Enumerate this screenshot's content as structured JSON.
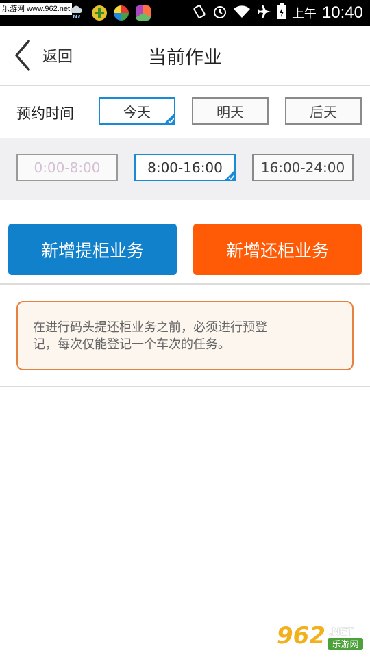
{
  "status_bar": {
    "watermark": "乐游网 www.962.net",
    "ampm": "上午",
    "time": "10:40",
    "icons": [
      "app-icon-1",
      "app-icon-2",
      "app-icon-3",
      "weather-icon",
      "game-icon",
      "color-app-icon",
      "colorful-app-icon",
      "rotate-icon",
      "alarm-icon",
      "wifi-icon",
      "airplane-icon",
      "battery-icon"
    ]
  },
  "header": {
    "back_label": "返回",
    "title": "当前作业"
  },
  "date_row": {
    "label": "预约时间",
    "options": [
      {
        "label": "今天",
        "selected": true
      },
      {
        "label": "明天",
        "selected": false
      },
      {
        "label": "后天",
        "selected": false
      }
    ]
  },
  "time_row": {
    "options": [
      {
        "label": "0:00-8:00",
        "disabled": true,
        "selected": false
      },
      {
        "label": "8:00-16:00",
        "disabled": false,
        "selected": true
      },
      {
        "label": "16:00-24:00",
        "disabled": false,
        "selected": false
      }
    ]
  },
  "actions": {
    "pickup_label": "新增提柜业务",
    "return_label": "新增还柜业务"
  },
  "notice": {
    "text_line1": "在进行码头提还柜业务之前，必须进行预登",
    "text_line2": "记，每次仅能登记一个车次的任务。"
  },
  "logo": {
    "main": "962",
    "suffix": ".NET",
    "sub": "乐游网"
  },
  "colors": {
    "accent_blue": "#1281cc",
    "accent_orange": "#ff5a06",
    "notice_border": "#e7813f",
    "notice_bg": "#fcf6ee"
  }
}
